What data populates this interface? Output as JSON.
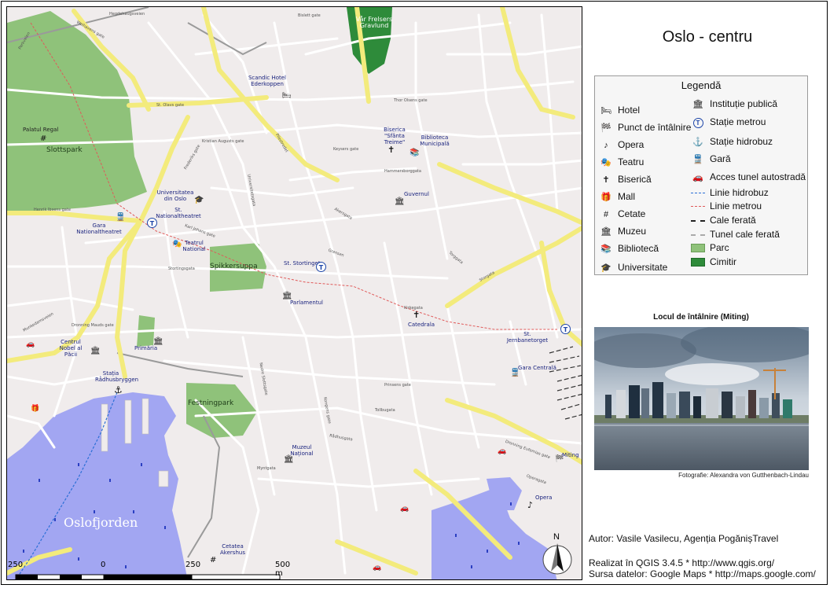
{
  "title": "Oslo - centru",
  "legend": {
    "title": "Legendă",
    "items_left": [
      {
        "icon": "hotel-icon",
        "glyph": "🛏",
        "label": "Hotel"
      },
      {
        "icon": "meeting-point-icon",
        "glyph": "🏁",
        "label": "Punct de întâlnire"
      },
      {
        "icon": "opera-icon",
        "glyph": "♪",
        "label": "Opera"
      },
      {
        "icon": "theatre-icon",
        "glyph": "🎭",
        "label": "Teatru"
      },
      {
        "icon": "church-icon",
        "glyph": "✝",
        "label": "Biserică"
      },
      {
        "icon": "mall-icon",
        "glyph": "🎁",
        "label": "Mall"
      },
      {
        "icon": "fortress-icon",
        "glyph": "#",
        "label": "Cetate"
      },
      {
        "icon": "museum-icon",
        "glyph": "🏛",
        "label": "Muzeu"
      },
      {
        "icon": "library-icon",
        "glyph": "📚",
        "label": "Bibliotecă"
      },
      {
        "icon": "university-icon",
        "glyph": "🎓",
        "label": "Universitate"
      }
    ],
    "items_right": [
      {
        "icon": "public-institution-icon",
        "glyph": "🏛",
        "label": "Instituție publică"
      },
      {
        "icon": "metro-station-icon",
        "glyph": "T",
        "label": "Stație metrou"
      },
      {
        "icon": "ferry-station-icon",
        "glyph": "⚓",
        "label": "Stație hidrobuz"
      },
      {
        "icon": "train-station-icon",
        "glyph": "🚆",
        "label": "Gară"
      },
      {
        "icon": "tunnel-access-icon",
        "glyph": "🚗",
        "label": "Acces tunel autostradă"
      },
      {
        "icon": "ferry-line-icon",
        "label": "Linie hidrobuz",
        "style": "dash-blue"
      },
      {
        "icon": "metro-line-icon",
        "label": "Linie metrou",
        "style": "dash-red"
      },
      {
        "icon": "railway-icon",
        "label": "Cale ferată",
        "style": "rail"
      },
      {
        "icon": "rail-tunnel-icon",
        "label": "Tunel cale ferată",
        "style": "rail-tunnel"
      },
      {
        "icon": "park-icon",
        "label": "Parc",
        "style": "park"
      },
      {
        "icon": "cemetery-icon",
        "label": "Cimitir",
        "style": "cemetery"
      }
    ]
  },
  "colors": {
    "park": "#8fc27a",
    "cemetery": "#2e8b3a",
    "water": "#a2a6f2",
    "major_road": "#f3eb7c",
    "minor_road": "#ffffff",
    "land": "#f0ecec",
    "ferry_line": "#2b6fd6",
    "metro_line": "#e05a5a"
  },
  "photo": {
    "title": "Locul de întâlnire (Miting)",
    "credit": "Fotografie: Alexandra von Gutthenbach-Lindau"
  },
  "map": {
    "labels": {
      "cemetery": "Vår Frelsers Gravlund",
      "slottspark": "Slottspark",
      "palatul": "Palatul Regal",
      "scandic": "Scandic Hotel Ederkoppen",
      "biserica": "Biserica \"Sfânta Treime\"",
      "biblioteca": "Biblioteca Municipală",
      "guvernul": "Guvernul",
      "universitatea": "Universitatea din Oslo",
      "nationaltheatret": "St. Nationaltheatret",
      "gara_nt": "Gara Nationaltheatret",
      "teatrul": "Teatrul National",
      "spikkersuppa": "Spikkersuppa",
      "st_stortinget": "St. Stortinget",
      "parlamentul": "Parlamentul",
      "catedrala": "Catedrala",
      "st_jernbanetorget": "St. Jernbanetorget",
      "gara_centrala": "Gara Centrală",
      "centrul_nobel": "Centrul Nobel al Păcii",
      "primaria": "Primăria",
      "statia_radhus": "Stația Rådhusbryggen",
      "festningpark": "Festningpark",
      "muzeul": "Muzeul Național",
      "miting": "Miting",
      "opera": "Opera",
      "cetatea": "Cetatea Akershus",
      "oslofjorden": "Oslofjorden"
    },
    "streets": [
      "Hegdehaugsveien",
      "Welhavens gate",
      "Parkveien",
      "Bislett gate",
      "St. Olavs gate",
      "Kristian Augusts gate",
      "Pilestredet",
      "Universitetsgata",
      "Keysers gate",
      "Akersgata",
      "Karl Johans gate",
      "Stortingsgata",
      "Grensen",
      "Torggata",
      "Storgata",
      "Prinsens gate",
      "Tollbugata",
      "Rådhusgata",
      "Kirkegata",
      "Dronning Mauds gate",
      "Munkedamsveien",
      "Henrik Ibsens gate",
      "Frederiks gate",
      "Thor Olsens gate",
      "Hammersborggata",
      "Dronning Eufemias gate",
      "Operagata",
      "Myntgata",
      "Kongens gate",
      "Nedre Slottsgate"
    ],
    "scale": {
      "labels": [
        "250",
        "0",
        "250",
        "500 m"
      ]
    },
    "north": "N"
  },
  "credits": {
    "author": "Autor: Vasile Vasilecu, Agenția PogănișTravel",
    "tools": "Realizat în QGIS 3.4.5 * http://www.qgis.org/",
    "source": "Sursa datelor: Google Maps * http://maps.google.com/"
  }
}
